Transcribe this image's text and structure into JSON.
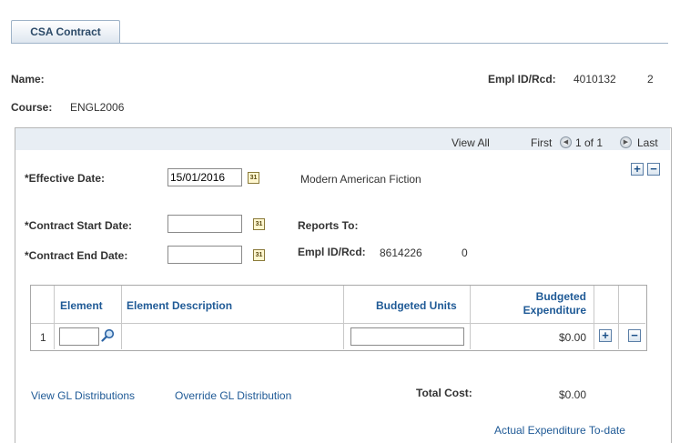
{
  "tab": {
    "label": "CSA Contract"
  },
  "header": {
    "name_label": "Name:",
    "empl_label": "Empl ID/Rcd:",
    "empl_id": "4010132",
    "empl_rcd": "2",
    "course_label": "Course:",
    "course_value": "ENGL2006"
  },
  "nav": {
    "view_all": "View All",
    "first": "First",
    "count": "1 of 1",
    "last": "Last"
  },
  "form": {
    "eff_date_label": "*Effective Date:",
    "eff_date_value": "15/01/2016",
    "course_title": "Modern American Fiction",
    "start_label": "*Contract Start Date:",
    "start_value": "",
    "end_label": "*Contract End Date:",
    "end_value": "",
    "reports_label": "Reports To:",
    "reports_empl_label": "Empl ID/Rcd:",
    "reports_empl_id": "8614226",
    "reports_empl_rcd": "0"
  },
  "grid": {
    "columns": [
      "Element",
      "Element Description",
      "Budgeted Units",
      "Budgeted Expenditure"
    ],
    "rows": [
      {
        "num": "1",
        "element": "",
        "description": "",
        "units": "",
        "expenditure": "$0.00"
      }
    ]
  },
  "footer": {
    "view_gl": "View GL Distributions",
    "override_gl": "Override GL Distribution",
    "total_label": "Total Cost:",
    "total_value": "$0.00",
    "actual_link": "Actual Expenditure To-date"
  },
  "icons": {
    "calendar": "calendar-icon",
    "lookup": "magnifier-icon",
    "prev": "left-arrow-icon",
    "next": "right-arrow-icon",
    "add": "plus-icon",
    "delete": "minus-icon"
  }
}
